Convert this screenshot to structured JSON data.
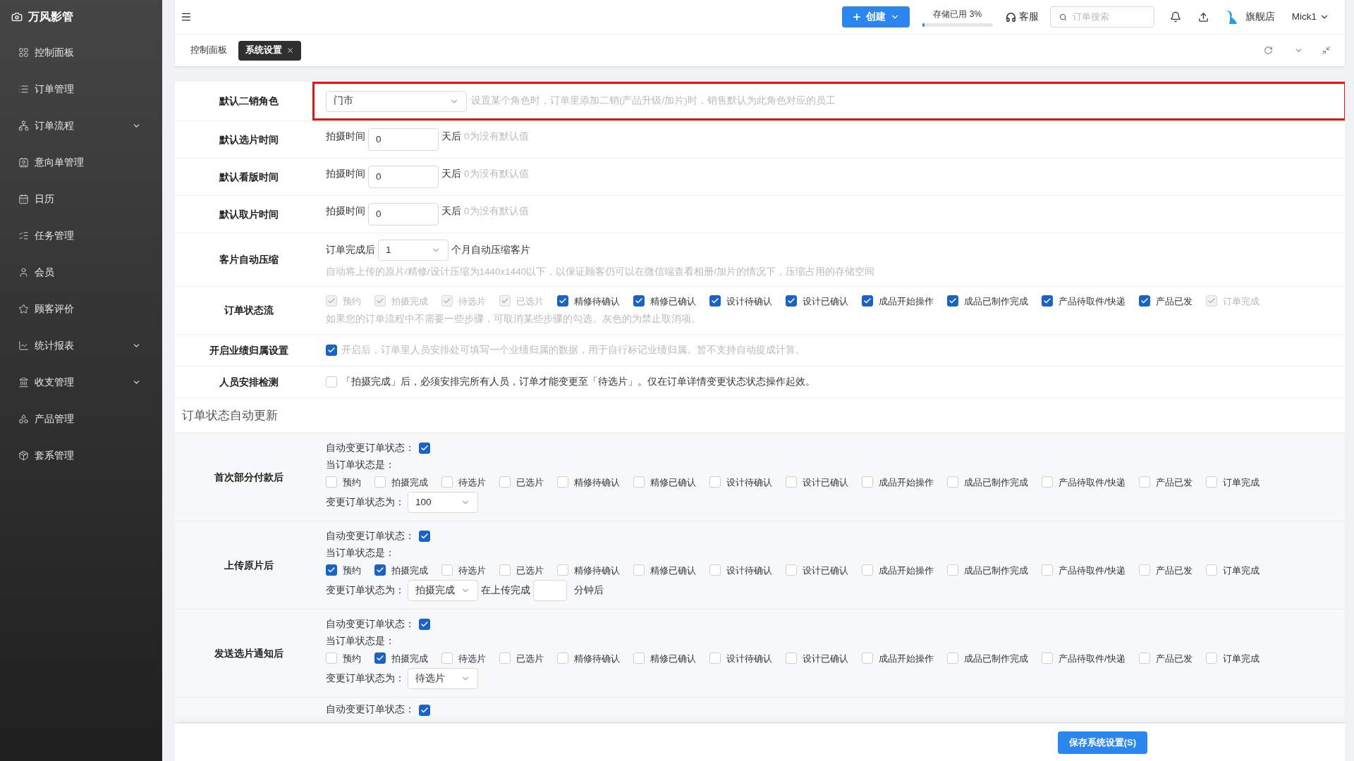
{
  "sidebar": {
    "brand": "万风影管",
    "items": [
      {
        "label": "控制面板",
        "expandable": false
      },
      {
        "label": "订单管理",
        "expandable": false
      },
      {
        "label": "订单流程",
        "expandable": true
      },
      {
        "label": "意向单管理",
        "expandable": false
      },
      {
        "label": "日历",
        "expandable": false
      },
      {
        "label": "任务管理",
        "expandable": false
      },
      {
        "label": "会员",
        "expandable": false
      },
      {
        "label": "顾客评价",
        "expandable": false
      },
      {
        "label": "统计报表",
        "expandable": true
      },
      {
        "label": "收支管理",
        "expandable": true
      },
      {
        "label": "产品管理",
        "expandable": false
      },
      {
        "label": "套系管理",
        "expandable": false
      }
    ]
  },
  "header": {
    "create_button": "创建",
    "storage": {
      "label": "存储已用 3%",
      "level": 0.03
    },
    "service": "客服",
    "search": {
      "placeholder": "订单搜索"
    },
    "store": "旗舰店",
    "user": "Mick1"
  },
  "tabs": [
    {
      "label": "控制面板",
      "selected": false,
      "closable": false
    },
    {
      "label": "系统设置",
      "selected": true,
      "closable": true
    }
  ],
  "settings": [
    {
      "kind": "select_hint",
      "label": "默认二销角色",
      "highlighted": true,
      "value": "门市",
      "hint": "设置某个角色时，订单里添加二销(产品升级/加片)时，销售默认为此角色对应的员工"
    },
    {
      "kind": "days",
      "label": "默认选片时间",
      "prefix": "拍摄时间",
      "value": "0",
      "suffix": "天后",
      "hint": "0为没有默认值"
    },
    {
      "kind": "days",
      "label": "默认看版时间",
      "prefix": "拍摄时间",
      "value": "0",
      "suffix": "天后",
      "hint": "0为没有默认值"
    },
    {
      "kind": "days",
      "label": "默认取片时间",
      "prefix": "拍摄时间",
      "value": "0",
      "suffix": "天后",
      "hint": "0为没有默认值"
    },
    {
      "kind": "compress",
      "label": "客片自动压缩",
      "prefix": "订单完成后",
      "value": "1",
      "suffix": "个月自动压缩客片",
      "hint": "自动将上传的原片/精修/设计压缩为1440x1440以下，以保证顾客仍可以在微信端查看相册/加片的情况下，压缩占用的存储空间"
    },
    {
      "kind": "status_flow",
      "label": "订单状态流",
      "statuses": [
        {
          "label": "预约",
          "checked": true,
          "disabled": true
        },
        {
          "label": "拍摄完成",
          "checked": true,
          "disabled": true
        },
        {
          "label": "待选片",
          "checked": true,
          "disabled": true
        },
        {
          "label": "已选片",
          "checked": true,
          "disabled": true
        },
        {
          "label": "精修待确认",
          "checked": true,
          "disabled": false
        },
        {
          "label": "精修已确认",
          "checked": true,
          "disabled": false
        },
        {
          "label": "设计待确认",
          "checked": true,
          "disabled": false
        },
        {
          "label": "设计已确认",
          "checked": true,
          "disabled": false
        },
        {
          "label": "成品开始操作",
          "checked": true,
          "disabled": false
        },
        {
          "label": "成品已制作完成",
          "checked": true,
          "disabled": false
        },
        {
          "label": "产品待取件/快递",
          "checked": true,
          "disabled": false
        },
        {
          "label": "产品已发",
          "checked": true,
          "disabled": false
        },
        {
          "label": "订单完成",
          "checked": true,
          "disabled": true
        }
      ],
      "hint": "如果您的订单流程中不需要一些步骤，可取消某些步骤的勾选。灰色的为禁止取消项。"
    },
    {
      "kind": "checkbox_hint",
      "label": "开启业绩归属设置",
      "checked": true,
      "text": "开启后，订单里人员安排处可填写一个业绩归属的数据，用于自行标记业绩归属。暂不支持自动提成计算。"
    },
    {
      "kind": "checkbox_text",
      "label": "人员安排检测",
      "checked": false,
      "text": "「拍摄完成」后，必须安排完所有人员，订单才能变更至「待选片」。仅在订单详情变更状态状态操作起效。"
    }
  ],
  "auto_update": {
    "title": "订单状态自动更新",
    "groups": [
      {
        "label": "首次部分付款后",
        "auto_label": "自动变更订单状态：",
        "auto": true,
        "current_label": "当订单状态是：",
        "statuses": [
          {
            "label": "预约",
            "checked": false
          },
          {
            "label": "拍摄完成",
            "checked": false
          },
          {
            "label": "待选片",
            "checked": false
          },
          {
            "label": "已选片",
            "checked": false
          },
          {
            "label": "精修待确认",
            "checked": false
          },
          {
            "label": "精修已确认",
            "checked": false
          },
          {
            "label": "设计待确认",
            "checked": false
          },
          {
            "label": "设计已确认",
            "checked": false
          },
          {
            "label": "成品开始操作",
            "checked": false
          },
          {
            "label": "成品已制作完成",
            "checked": false
          },
          {
            "label": "产品待取件/快递",
            "checked": false
          },
          {
            "label": "产品已发",
            "checked": false
          },
          {
            "label": "订单完成",
            "checked": false
          }
        ],
        "target_label": "变更订单状态为：",
        "target": "100"
      },
      {
        "label": "上传原片后",
        "auto_label": "自动变更订单状态：",
        "auto": true,
        "current_label": "当订单状态是：",
        "statuses": [
          {
            "label": "预约",
            "checked": true
          },
          {
            "label": "拍摄完成",
            "checked": true
          },
          {
            "label": "待选片",
            "checked": false
          },
          {
            "label": "已选片",
            "checked": false
          },
          {
            "label": "精修待确认",
            "checked": false
          },
          {
            "label": "精修已确认",
            "checked": false
          },
          {
            "label": "设计待确认",
            "checked": false
          },
          {
            "label": "设计已确认",
            "checked": false
          },
          {
            "label": "成品开始操作",
            "checked": false
          },
          {
            "label": "成品已制作完成",
            "checked": false
          },
          {
            "label": "产品待取件/快递",
            "checked": false
          },
          {
            "label": "产品已发",
            "checked": false
          },
          {
            "label": "订单完成",
            "checked": false
          }
        ],
        "target_label": "变更订单状态为：",
        "target": "拍摄完成",
        "delay": {
          "prefix": "在上传完成",
          "suffix": "分钟后"
        }
      },
      {
        "label": "发送选片通知后",
        "auto_label": "自动变更订单状态：",
        "auto": true,
        "current_label": "当订单状态是：",
        "statuses": [
          {
            "label": "预约",
            "checked": false
          },
          {
            "label": "拍摄完成",
            "checked": true
          },
          {
            "label": "待选片",
            "checked": false
          },
          {
            "label": "已选片",
            "checked": false
          },
          {
            "label": "精修待确认",
            "checked": false
          },
          {
            "label": "精修已确认",
            "checked": false
          },
          {
            "label": "设计待确认",
            "checked": false
          },
          {
            "label": "设计已确认",
            "checked": false
          },
          {
            "label": "成品开始操作",
            "checked": false
          },
          {
            "label": "成品已制作完成",
            "checked": false
          },
          {
            "label": "产品待取件/快递",
            "checked": false
          },
          {
            "label": "产品已发",
            "checked": false
          },
          {
            "label": "订单完成",
            "checked": false
          }
        ],
        "target_label": "变更订单状态为：",
        "target": "待选片"
      },
      {
        "auto_label": "自动变更订单状态：",
        "auto": true
      }
    ]
  },
  "save_button": "保存系统设置(S)"
}
